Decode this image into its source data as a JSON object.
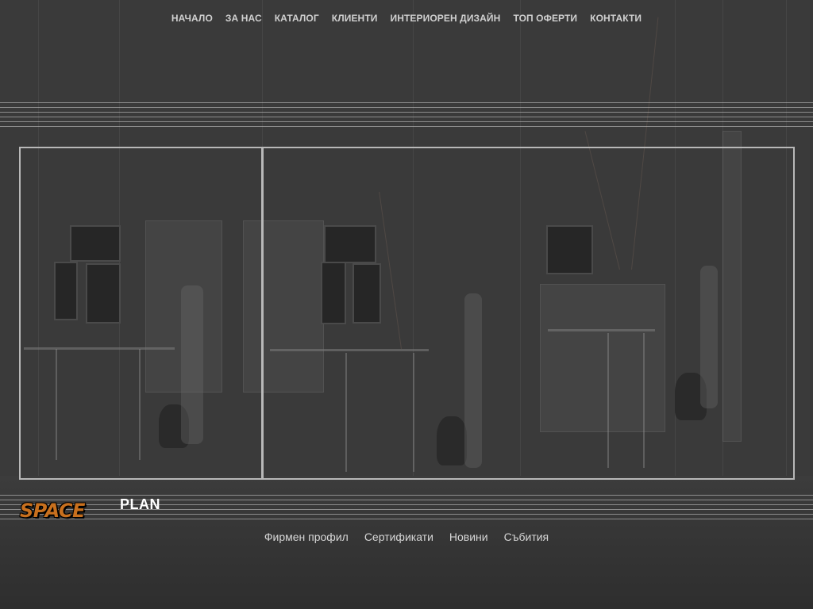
{
  "nav": {
    "items": [
      {
        "label": "НАЧАЛО"
      },
      {
        "label": "ЗА НАС"
      },
      {
        "label": "КАТАЛОГ"
      },
      {
        "label": "КЛИЕНТИ"
      },
      {
        "label": "ИНТЕРИОРЕН ДИЗАЙН"
      },
      {
        "label": "ТОП ОФЕРТИ"
      },
      {
        "label": "КОНТАКТИ"
      }
    ]
  },
  "logo": {
    "word1": "SPACE",
    "word2": "PLAN",
    "accent_color": "#c8701e"
  },
  "footer": {
    "links": [
      {
        "label": "Фирмен профил"
      },
      {
        "label": "Сертификати"
      },
      {
        "label": "Новини"
      },
      {
        "label": "Събития"
      }
    ]
  }
}
